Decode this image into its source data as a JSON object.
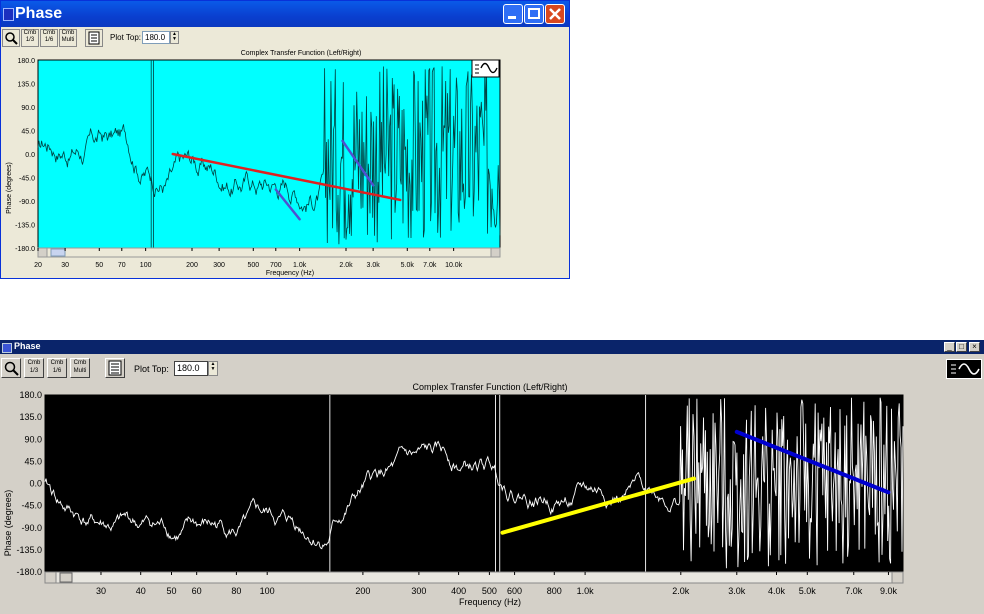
{
  "window1": {
    "title": "Phase",
    "toolbar": {
      "zoom_icon": "magnifier-icon",
      "btn1": "Cmb 1/3",
      "btn2": "Cmb 1/6",
      "btn3": "Cmb Multi",
      "notes_icon": "notepad-icon",
      "plot_top_label": "Plot Top:",
      "plot_top_value": "180.0"
    },
    "chart": {
      "title": "Complex Transfer Function (Left/Right)",
      "xlabel": "Frequency (Hz)",
      "ylabel": "Phase (degrees)",
      "yticks": [
        "180.0",
        "135.0",
        "90.0",
        "45.0",
        "0.0",
        "-45.0",
        "-90.0",
        "-135.0",
        "-180.0"
      ],
      "xticks": [
        "20",
        "30",
        "50",
        "70",
        "100",
        "200",
        "300",
        "500",
        "700",
        "1.0k",
        "2.0k",
        "3.0k",
        "5.0k",
        "7.0k",
        "10.0k"
      ],
      "background": "#00ffff",
      "trace_color": "#004040"
    },
    "annotations": [
      {
        "color": "#e02020",
        "from_hz": 150,
        "from_deg": 0,
        "to_hz": 4500,
        "to_deg": -88
      },
      {
        "color": "#5050d0",
        "from_hz": 700,
        "from_deg": -68,
        "to_hz": 1000,
        "to_deg": -125
      },
      {
        "color": "#5050d0",
        "from_hz": 1900,
        "from_deg": 25,
        "to_hz": 3000,
        "to_deg": -60
      }
    ]
  },
  "window2": {
    "title": "Phase",
    "toolbar": {
      "zoom_icon": "magnifier-icon",
      "btn1": "Cmb 1/3",
      "btn2": "Cmb 1/6",
      "btn3": "Cmb Multi",
      "notes_icon": "notepad-icon",
      "plot_top_label": "Plot Top:",
      "plot_top_value": "180.0"
    },
    "chart": {
      "title": "Complex Transfer Function (Left/Right)",
      "xlabel": "Frequency (Hz)",
      "ylabel": "Phase (degrees)",
      "yticks": [
        "180.0",
        "135.0",
        "90.0",
        "45.0",
        "0.0",
        "-45.0",
        "-90.0",
        "-135.0",
        "-180.0"
      ],
      "xticks": [
        "30",
        "40",
        "50",
        "60",
        "80",
        "100",
        "200",
        "300",
        "400",
        "500",
        "600",
        "800",
        "1.0k",
        "2.0k",
        "3.0k",
        "4.0k",
        "5.0k",
        "7.0k",
        "9.0k"
      ],
      "background": "#000000",
      "trace_color": "#ffffff"
    },
    "annotations": [
      {
        "color": "#ffff00",
        "from_hz": 550,
        "from_deg": -100,
        "to_hz": 2200,
        "to_deg": 10
      },
      {
        "color": "#0000d0",
        "from_hz": 3000,
        "from_deg": 105,
        "to_hz": 9000,
        "to_deg": -18
      }
    ]
  }
}
